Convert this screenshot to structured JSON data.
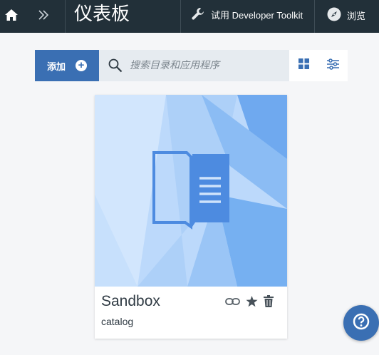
{
  "topbar": {
    "title": "仪表板",
    "toolkit_label": "试用 Developer Toolkit",
    "browse_label": "浏览"
  },
  "toolbar": {
    "add_label": "添加",
    "search_placeholder": "搜索目录和应用程序"
  },
  "card": {
    "name": "Sandbox",
    "type": "catalog"
  },
  "colors": {
    "topbar_bg": "#223039",
    "accent": "#3a6fb3",
    "card_art_light": "#cfe3fb",
    "card_art_dark": "#5e9ae8"
  },
  "icons": {
    "home": "home-icon",
    "expand": "double-chevron-right-icon",
    "toolkit": "wrench-icon",
    "browse": "compass-icon",
    "add": "plus-circle-icon",
    "search": "search-icon",
    "grid_view": "grid-icon",
    "filter": "sliders-icon",
    "link": "link-icon",
    "favorite": "star-icon",
    "delete": "trash-icon",
    "help": "help-icon",
    "catalog": "book-icon"
  }
}
